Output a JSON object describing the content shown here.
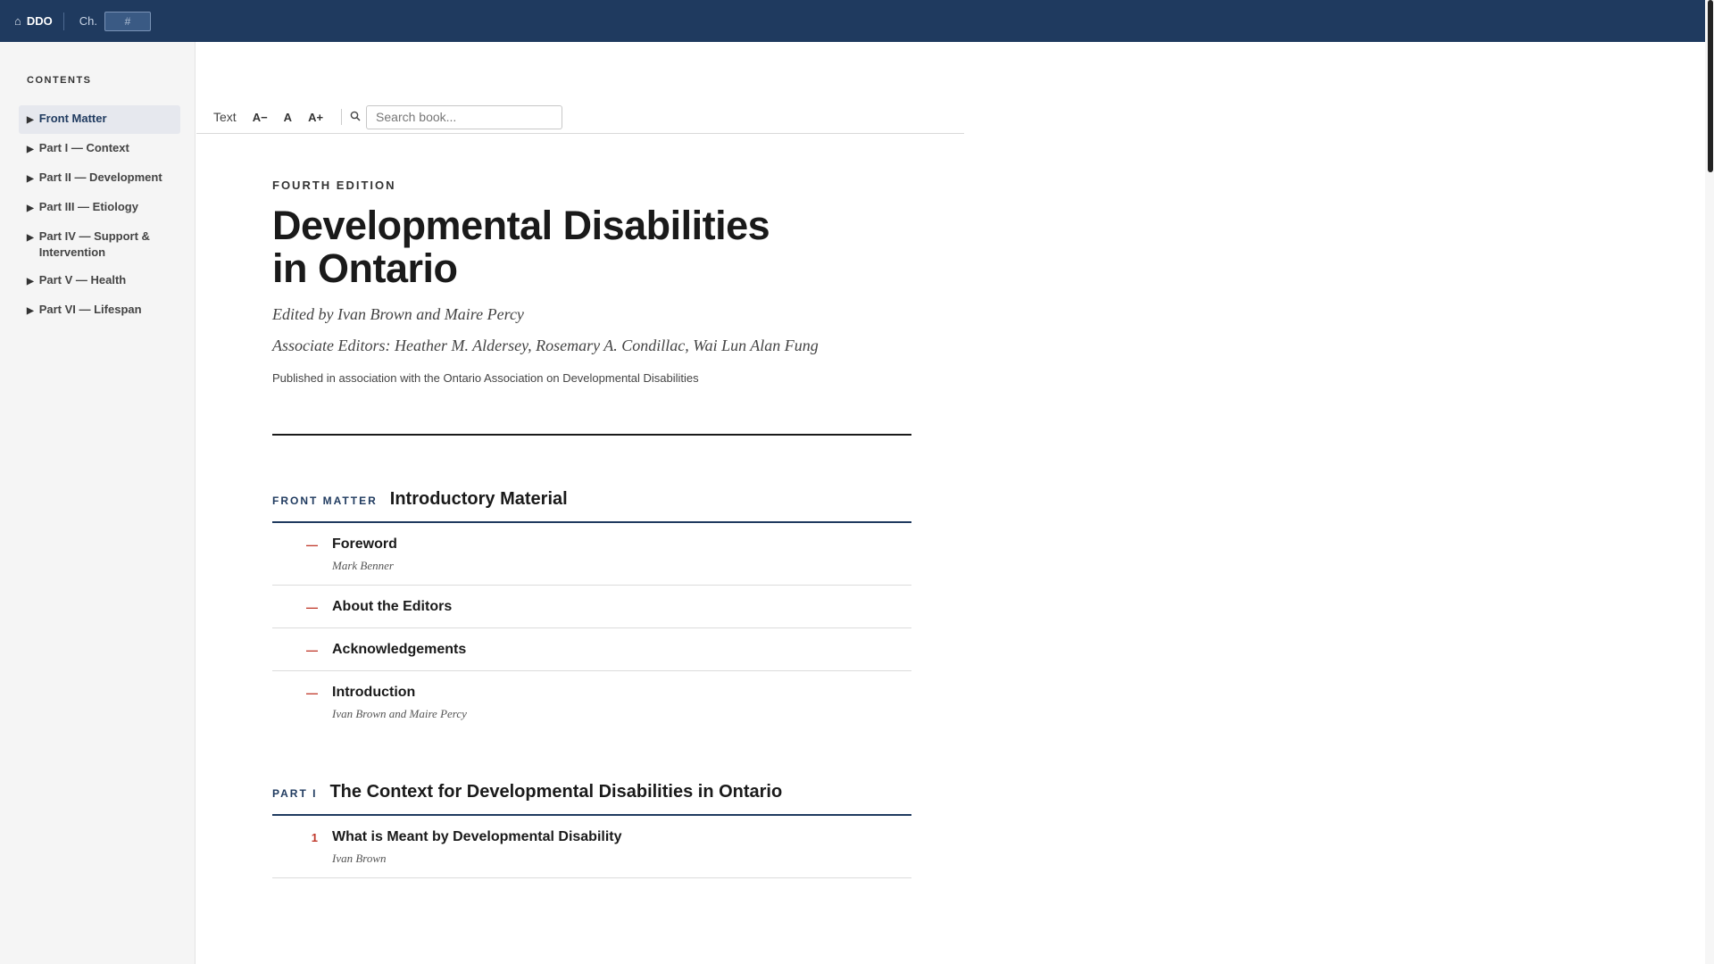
{
  "topbar": {
    "home_label": "DDO",
    "chapter_label": "Ch.",
    "chapter_placeholder": "#"
  },
  "sidebar": {
    "heading": "CONTENTS",
    "items": [
      {
        "label": "Front Matter",
        "active": true
      },
      {
        "label": "Part I — Context"
      },
      {
        "label": "Part II — Development"
      },
      {
        "label": "Part III — Etiology"
      },
      {
        "label": "Part IV — Support & Intervention"
      },
      {
        "label": "Part V — Health"
      },
      {
        "label": "Part VI — Lifespan"
      }
    ]
  },
  "toolbar": {
    "text_label": "Text",
    "decrease": "A−",
    "reset": "A",
    "increase": "A+",
    "search_placeholder": "Search book..."
  },
  "book": {
    "edition": "FOURTH EDITION",
    "title_line1": "Developmental Disabilities",
    "title_line2": "in Ontario",
    "editors": "Edited by Ivan Brown and Maire Percy",
    "associate_editors": "Associate Editors: Heather M. Aldersey, Rosemary A. Condillac, Wai Lun Alan Fung",
    "published": "Published in association with the Ontario Association on Developmental Disabilities"
  },
  "sections": [
    {
      "tag": "FRONT MATTER",
      "title": "Introductory Material",
      "entries": [
        {
          "num": "—",
          "title": "Foreword",
          "author": "Mark Benner"
        },
        {
          "num": "—",
          "title": "About the Editors"
        },
        {
          "num": "—",
          "title": "Acknowledgements"
        },
        {
          "num": "—",
          "title": "Introduction",
          "author": "Ivan Brown and Maire Percy"
        }
      ]
    },
    {
      "tag": "PART I",
      "title": "The Context for Developmental Disabilities in Ontario",
      "entries": [
        {
          "num": "1",
          "title": "What is Meant by Developmental Disability",
          "author": "Ivan Brown"
        }
      ]
    }
  ]
}
